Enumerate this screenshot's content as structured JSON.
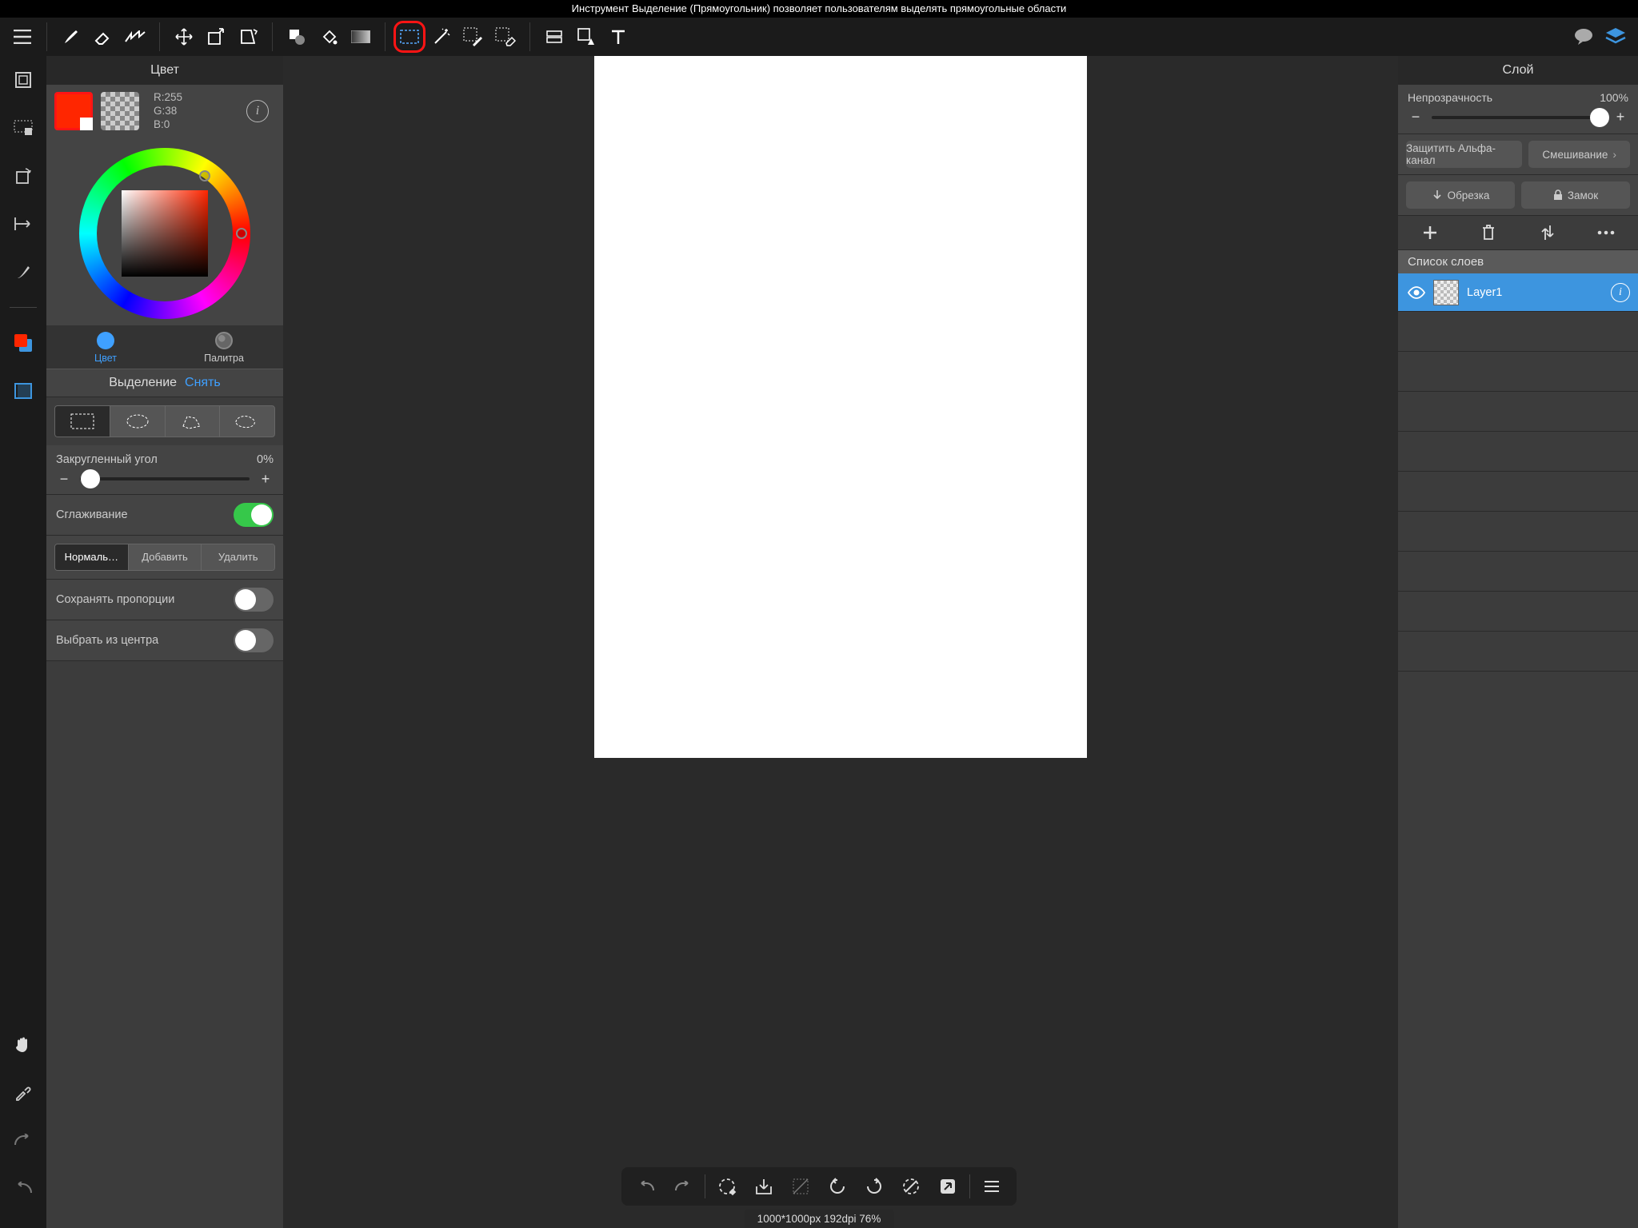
{
  "tooltip": "Инструмент Выделение (Прямоугольник) позволяет пользователям выделять прямоугольные области",
  "colorPanel": {
    "title": "Цвет",
    "rgb": {
      "r": "R:255",
      "g": "G:38",
      "b": "B:0"
    },
    "tabColor": "Цвет",
    "tabPalette": "Палитра"
  },
  "selectionPanel": {
    "title": "Выделение",
    "clear": "Снять",
    "roundedCorner": {
      "label": "Закругленный угол",
      "value": "0%"
    },
    "antialias": "Сглаживание",
    "modes": {
      "normal": "Нормаль…",
      "add": "Добавить",
      "remove": "Удалить"
    },
    "keepRatio": "Сохранять пропорции",
    "fromCenter": "Выбрать из центра"
  },
  "layerPanel": {
    "title": "Слой",
    "opacity": {
      "label": "Непрозрачность",
      "value": "100%"
    },
    "protectAlpha": "Защитить Альфа-канал",
    "blending": "Смешивание",
    "crop": "Обрезка",
    "lock": "Замок",
    "listHead": "Список слоев",
    "layer1": "Layer1"
  },
  "status": "1000*1000px 192dpi 76%"
}
